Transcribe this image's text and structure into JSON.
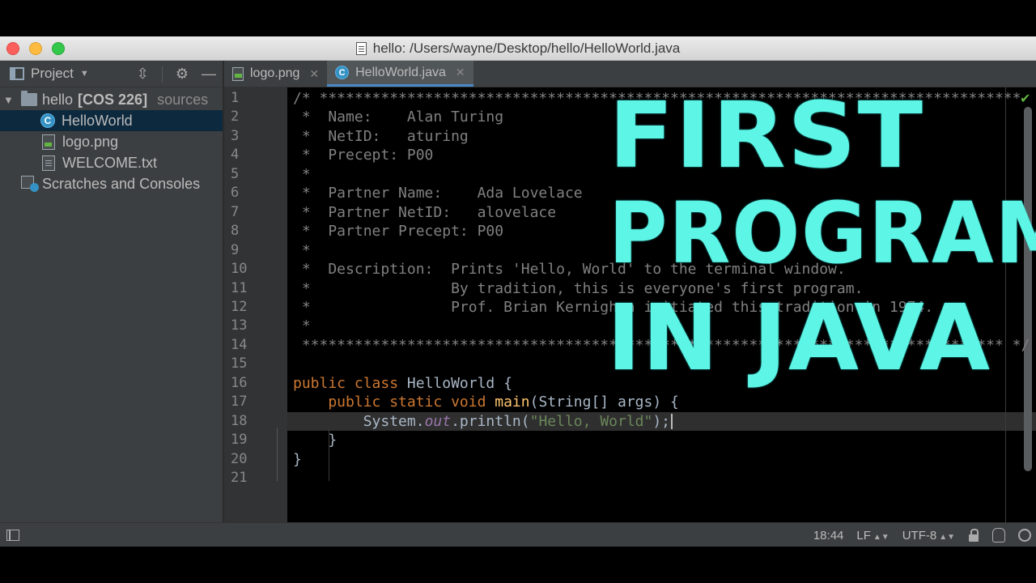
{
  "window": {
    "title": "hello:  /Users/wayne/Desktop/hello/HelloWorld.java"
  },
  "project_panel": {
    "header_label": "Project",
    "tree": [
      {
        "name": "hello",
        "badge": "[COS 226]",
        "suffix": "sources",
        "icon": "folder-icon"
      },
      {
        "name": "HelloWorld",
        "icon": "java-class-icon",
        "selected": true
      },
      {
        "name": "logo.png",
        "icon": "image-file-icon"
      },
      {
        "name": "WELCOME.txt",
        "icon": "text-file-icon"
      },
      {
        "name": "Scratches and Consoles",
        "icon": "scratches-icon"
      }
    ]
  },
  "tabs": [
    {
      "label": "logo.png",
      "icon": "image-file-icon",
      "active": false
    },
    {
      "label": "HelloWorld.java",
      "icon": "java-class-icon",
      "active": true
    }
  ],
  "editor": {
    "line_numbers": [
      "1",
      "2",
      "3",
      "4",
      "5",
      "6",
      "7",
      "8",
      "9",
      "10",
      "11",
      "12",
      "13",
      "14",
      "15",
      "16",
      "17",
      "18",
      "19",
      "20",
      "21"
    ],
    "current_line": 18,
    "lines": [
      [
        {
          "t": "/* ********************************************************************************",
          "c": "c-comment"
        }
      ],
      [
        {
          "t": " *  Name:    Alan Turing",
          "c": "c-comment"
        }
      ],
      [
        {
          "t": " *  NetID:   aturing",
          "c": "c-comment"
        }
      ],
      [
        {
          "t": " *  Precept: P00",
          "c": "c-comment"
        }
      ],
      [
        {
          "t": " *",
          "c": "c-comment"
        }
      ],
      [
        {
          "t": " *  Partner Name:    Ada Lovelace",
          "c": "c-comment"
        }
      ],
      [
        {
          "t": " *  Partner NetID:   alovelace",
          "c": "c-comment"
        }
      ],
      [
        {
          "t": " *  Partner Precept: P00",
          "c": "c-comment"
        }
      ],
      [
        {
          "t": " *",
          "c": "c-comment"
        }
      ],
      [
        {
          "t": " *  Description:  Prints 'Hello, World' to the terminal window.",
          "c": "c-comment"
        }
      ],
      [
        {
          "t": " *                By tradition, this is everyone's first program.",
          "c": "c-comment"
        }
      ],
      [
        {
          "t": " *                Prof. Brian Kernighan initiated this tradition in 1974.",
          "c": "c-comment"
        }
      ],
      [
        {
          "t": " *",
          "c": "c-comment"
        }
      ],
      [
        {
          "t": " ******************************************************************************** */",
          "c": "c-comment"
        }
      ],
      [],
      [
        {
          "t": "public class ",
          "c": "c-kw"
        },
        {
          "t": "HelloWorld {",
          "c": "c-class"
        }
      ],
      [
        {
          "t": "    public static void ",
          "c": "c-kw"
        },
        {
          "t": "main",
          "c": "c-method"
        },
        {
          "t": "(String[] args) {",
          "c": "c-type"
        }
      ],
      [
        {
          "t": "        System.",
          "c": "c-type"
        },
        {
          "t": "out",
          "c": "c-field"
        },
        {
          "t": ".println(",
          "c": "c-type"
        },
        {
          "t": "\"Hello, World\"",
          "c": "c-str"
        },
        {
          "t": ");",
          "c": "c-type"
        }
      ],
      [
        {
          "t": "    }",
          "c": "c-type"
        }
      ],
      [
        {
          "t": "}",
          "c": "c-type"
        }
      ],
      []
    ]
  },
  "overlay": {
    "line1": "FIRST",
    "line2": "PROGRAM",
    "line3": "IN JAVA",
    "color": "#5df5e5"
  },
  "statusbar": {
    "position": "18:44",
    "line_separator": "LF",
    "encoding": "UTF-8"
  },
  "colors": {
    "accent": "#4a88c7",
    "keyword": "#cc7832",
    "string": "#6a8759",
    "comment": "#808080"
  }
}
